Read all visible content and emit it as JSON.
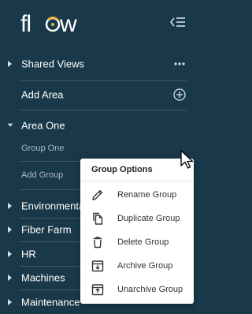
{
  "app": {
    "logo_text": "flow"
  },
  "colors": {
    "sidebar_bg": "#19394a",
    "accent": "#f2b134",
    "menu_bg": "#ffffff"
  },
  "header": {
    "collapse_icon": "collapse-sidebar-icon"
  },
  "sections": {
    "shared_views": {
      "label": "Shared Views",
      "action_icon": "more-dots-icon"
    },
    "add_area": {
      "label": "Add Area",
      "action_icon": "plus-circle-icon"
    },
    "area_one": {
      "label": "Area One",
      "group_one": "Group One",
      "add_group": "Add Group"
    },
    "areas": [
      {
        "label": "Environmental"
      },
      {
        "label": "Fiber Farm"
      },
      {
        "label": "HR"
      },
      {
        "label": "Machines"
      },
      {
        "label": "Maintenance"
      }
    ]
  },
  "context_menu": {
    "title": "Group Options",
    "items": [
      {
        "label": "Rename Group",
        "icon": "pencil-icon"
      },
      {
        "label": "Duplicate Group",
        "icon": "duplicate-icon"
      },
      {
        "label": "Delete Group",
        "icon": "trash-icon"
      },
      {
        "label": "Archive Group",
        "icon": "archive-icon"
      },
      {
        "label": "Unarchive Group",
        "icon": "unarchive-icon"
      }
    ]
  }
}
